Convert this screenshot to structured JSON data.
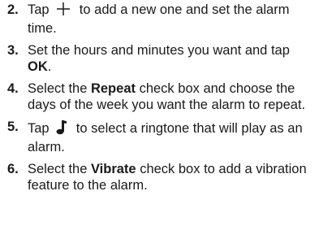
{
  "steps": [
    {
      "number": "2.",
      "before_icon": "Tap",
      "icon": "plus-icon",
      "after_icon": "to add a new one and set the alarm time."
    },
    {
      "number": "3.",
      "text_before": "Set the hours and minutes you want and tap ",
      "bold": "OK",
      "text_after": "."
    },
    {
      "number": "4.",
      "text_before": "Select the ",
      "bold": "Repeat",
      "text_after": " check box and choose the days of the week you want the alarm to repeat."
    },
    {
      "number": "5.",
      "before_icon": "Tap",
      "icon": "music-note-icon",
      "after_icon": "to select a ringtone that will play as an alarm."
    },
    {
      "number": "6.",
      "text_before": "Select the ",
      "bold": "Vibrate",
      "text_after": " check box to add a vibration feature to the alarm."
    }
  ]
}
